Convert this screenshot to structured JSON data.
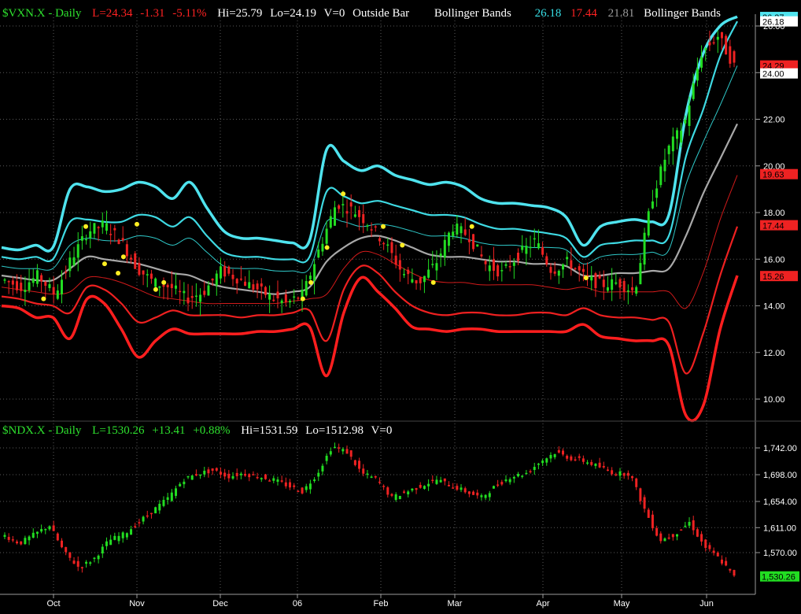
{
  "colors": {
    "background": "#000000",
    "grid": "#5a5a5a",
    "axis_line": "#9a9a9a",
    "axis_text": "#ffffff",
    "upper_thick": "#4fe3ee",
    "upper_mid": "#3ed9e2",
    "upper_thin": "#2fc9c9",
    "middle": "#a8a8a8",
    "lower_thin": "#d01a1a",
    "lower_mid": "#ee2020",
    "lower_thick": "#ff1e1e",
    "candle_up": "#22dd22",
    "candle_down": "#ee2222",
    "marker": "#ffee22",
    "header_green": "#2ee02e",
    "header_red": "#ff2222",
    "header_white": "#ffffff",
    "header_cyan": "#37dfe6",
    "header_gray": "#9a9a9a"
  },
  "top_header": {
    "symbol": "$VXN.X - Daily",
    "last": "L=24.34",
    "change": "-1.31",
    "pct": "-5.11%",
    "hi": "Hi=25.79",
    "lo": "Lo=24.19",
    "vol": "V=0",
    "pattern": "Outside Bar",
    "bb_label": "Bollinger Bands",
    "bb_upper": "26.18",
    "bb_lower": "17.44",
    "bb_mid": "21.81",
    "bb_label2": "Bollinger Bands"
  },
  "bottom_header": {
    "symbol": "$NDX.X - Daily",
    "last": "L=1530.26",
    "change": "+13.41",
    "pct": "+0.88%",
    "hi": "Hi=1531.59",
    "lo": "Lo=1512.98",
    "vol": "V=0"
  },
  "top_axis": {
    "ticks": [
      {
        "v": 26,
        "label": "26.00"
      },
      {
        "v": 24,
        "label": "24.00"
      },
      {
        "v": 22,
        "label": "22.00"
      },
      {
        "v": 20,
        "label": "20.00"
      },
      {
        "v": 18,
        "label": "18.00"
      },
      {
        "v": 16,
        "label": "16.00"
      },
      {
        "v": 14,
        "label": "14.00"
      },
      {
        "v": 12,
        "label": "12.00"
      },
      {
        "v": 10,
        "label": "10.00"
      }
    ],
    "badges": [
      {
        "v": 26.37,
        "label": "26.37",
        "bg": "#4fe3ee",
        "fg": "#000000"
      },
      {
        "v": 26.18,
        "label": "26.18",
        "bg": "#ffffff",
        "fg": "#000000"
      },
      {
        "v": 24.29,
        "label": "24.29",
        "bg": "#ee2222",
        "fg": "#000000"
      },
      {
        "v": 23.95,
        "label": "24.00",
        "bg": "#ffffff",
        "fg": "#000000"
      },
      {
        "v": 19.63,
        "label": "19.63",
        "bg": "#ee2222",
        "fg": "#000000"
      },
      {
        "v": 17.44,
        "label": "17.44",
        "bg": "#ee2222",
        "fg": "#000000"
      },
      {
        "v": 15.26,
        "label": "15.26",
        "bg": "#ee2222",
        "fg": "#000000"
      }
    ]
  },
  "bottom_axis": {
    "ticks": [
      {
        "v": 1742,
        "label": "1,742.00"
      },
      {
        "v": 1698,
        "label": "1,698.00"
      },
      {
        "v": 1654,
        "label": "1,654.00"
      },
      {
        "v": 1611,
        "label": "1,611.00"
      },
      {
        "v": 1570,
        "label": "1,570.00"
      }
    ],
    "badges": [
      {
        "v": 1530.26,
        "label": "1,530.26",
        "bg": "#22dd22",
        "fg": "#000000"
      }
    ]
  },
  "x_labels": [
    "Oct",
    "Nov",
    "Dec",
    "06",
    "Feb",
    "Mar",
    "Apr",
    "May",
    "Jun"
  ],
  "chart_data": [
    {
      "type": "candlestick",
      "title": "$VXN.X - Daily",
      "ylim": [
        9,
        27
      ],
      "grid": true,
      "months": [
        "Oct",
        "Nov",
        "Dec",
        "06",
        "Feb",
        "Mar",
        "Apr",
        "May",
        "Jun"
      ],
      "series": [
        {
          "name": "Upper Band (outer)",
          "values": [
            16.5,
            16.4,
            16.6,
            16.5,
            19.0,
            19.1,
            18.9,
            19.0,
            19.3,
            19.1,
            18.6,
            19.3,
            18.2,
            17.2,
            16.9,
            16.9,
            16.8,
            16.7,
            16.8,
            20.7,
            20.2,
            19.8,
            20.0,
            19.6,
            19.4,
            19.2,
            19.3,
            19.1,
            18.6,
            18.4,
            18.4,
            18.3,
            18.2,
            17.8,
            16.6,
            17.4,
            17.6,
            17.7,
            17.6,
            17.9,
            22.2,
            24.8,
            26.0,
            26.4
          ]
        },
        {
          "name": "Upper Band (mid)",
          "values": [
            16.1,
            16.0,
            16.1,
            16.0,
            17.6,
            17.7,
            17.6,
            17.6,
            17.9,
            17.8,
            17.4,
            17.8,
            17.0,
            16.3,
            16.1,
            16.1,
            16.0,
            16.0,
            16.1,
            18.9,
            18.7,
            18.4,
            18.5,
            18.3,
            18.1,
            17.9,
            17.9,
            17.8,
            17.5,
            17.3,
            17.3,
            17.2,
            17.1,
            16.9,
            16.1,
            16.6,
            16.7,
            16.8,
            16.8,
            17.0,
            20.4,
            22.4,
            24.7,
            26.2
          ]
        },
        {
          "name": "Upper Band (inner)",
          "values": [
            15.7,
            15.6,
            15.6,
            15.6,
            16.6,
            16.9,
            16.8,
            16.8,
            17.0,
            16.9,
            16.6,
            16.9,
            16.3,
            15.7,
            15.6,
            15.6,
            15.5,
            15.5,
            15.6,
            17.6,
            17.6,
            17.4,
            17.5,
            17.4,
            17.2,
            17.0,
            17.0,
            16.9,
            16.7,
            16.6,
            16.6,
            16.5,
            16.5,
            16.4,
            15.8,
            16.1,
            16.2,
            16.2,
            16.3,
            16.4,
            19.2,
            21.0,
            22.6,
            24.3
          ]
        },
        {
          "name": "Middle Band",
          "values": [
            15.3,
            15.2,
            15.1,
            15.1,
            15.6,
            16.1,
            16.0,
            15.9,
            15.8,
            15.6,
            15.4,
            15.3,
            15.0,
            14.8,
            14.7,
            14.6,
            14.5,
            14.6,
            14.8,
            15.9,
            16.5,
            16.9,
            17.0,
            16.8,
            16.5,
            16.2,
            16.1,
            16.1,
            16.0,
            15.9,
            15.9,
            15.8,
            15.8,
            15.7,
            15.3,
            15.3,
            15.4,
            15.4,
            15.5,
            15.6,
            17.0,
            18.8,
            20.3,
            21.8
          ]
        },
        {
          "name": "Lower Band (inner)",
          "values": [
            14.8,
            14.7,
            14.6,
            14.5,
            14.6,
            15.2,
            15.2,
            15.0,
            14.7,
            14.4,
            14.3,
            14.2,
            14.1,
            14.1,
            14.1,
            14.1,
            14.1,
            14.2,
            14.3,
            14.5,
            15.6,
            16.3,
            16.2,
            15.8,
            15.4,
            15.1,
            15.0,
            15.0,
            14.9,
            14.9,
            14.9,
            14.9,
            14.8,
            14.7,
            14.8,
            14.6,
            14.6,
            14.6,
            14.6,
            14.6,
            13.9,
            15.4,
            17.7,
            19.6
          ]
        },
        {
          "name": "Lower Band (mid)",
          "values": [
            14.4,
            14.3,
            14.1,
            14.0,
            13.7,
            14.8,
            14.7,
            14.1,
            13.3,
            13.5,
            13.8,
            13.6,
            13.6,
            13.6,
            13.5,
            13.6,
            13.6,
            13.7,
            13.8,
            12.5,
            14.7,
            15.7,
            15.4,
            14.6,
            14.0,
            13.7,
            13.6,
            13.7,
            13.7,
            13.6,
            13.6,
            13.7,
            13.7,
            13.6,
            13.9,
            13.6,
            13.5,
            13.5,
            13.4,
            13.3,
            11.1,
            12.8,
            15.3,
            17.4
          ]
        },
        {
          "name": "Lower Band (outer)",
          "values": [
            14.0,
            13.9,
            13.5,
            13.5,
            12.6,
            14.3,
            14.1,
            13.0,
            11.8,
            12.5,
            13.0,
            12.8,
            12.8,
            12.8,
            12.8,
            12.9,
            12.9,
            13.0,
            13.1,
            11.0,
            13.7,
            15.2,
            14.6,
            13.9,
            13.1,
            13.0,
            12.9,
            13.0,
            13.0,
            12.9,
            12.9,
            12.9,
            12.9,
            12.9,
            13.2,
            12.7,
            12.6,
            12.5,
            12.5,
            12.3,
            9.3,
            9.7,
            13.0,
            15.3
          ]
        }
      ],
      "candles": [
        15.1,
        14.8,
        15.3,
        14.5,
        16.0,
        17.2,
        17.5,
        16.8,
        15.6,
        15.0,
        14.8,
        14.3,
        14.6,
        15.5,
        15.2,
        14.8,
        14.4,
        14.1,
        14.5,
        16.5,
        18.4,
        18.1,
        17.5,
        16.6,
        15.4,
        15.0,
        15.8,
        17.4,
        17.0,
        15.8,
        15.4,
        16.2,
        16.8,
        15.5,
        15.9,
        15.2,
        14.9,
        15.0,
        14.6,
        18.5,
        20.7,
        21.8,
        24.8,
        25.6,
        24.3
      ],
      "markers": [
        {
          "date": "Sep-27",
          "y": 14.3
        },
        {
          "date": "Oct-12",
          "y": 17.4
        },
        {
          "date": "Oct-19",
          "y": 15.8
        },
        {
          "date": "Oct-24",
          "y": 15.4
        },
        {
          "date": "Oct-26",
          "y": 16.1
        },
        {
          "date": "Oct-31",
          "y": 17.5
        },
        {
          "date": "Nov-07",
          "y": 14.7
        },
        {
          "date": "Nov-10",
          "y": 15.0
        },
        {
          "date": "Jan-02",
          "y": 14.3
        },
        {
          "date": "Jan-05",
          "y": 15.0
        },
        {
          "date": "Jan-11",
          "y": 16.5
        },
        {
          "date": "Jan-17",
          "y": 18.8
        },
        {
          "date": "Feb-01",
          "y": 17.4
        },
        {
          "date": "Feb-09",
          "y": 16.6
        },
        {
          "date": "Feb-22",
          "y": 15.0
        },
        {
          "date": "Mar-06",
          "y": 17.4
        },
        {
          "date": "Apr-17",
          "y": 15.2
        }
      ]
    },
    {
      "type": "candlestick",
      "title": "$NDX.X - Daily",
      "ylim": [
        1522,
        1765
      ],
      "grid": true,
      "months": [
        "Oct",
        "Nov",
        "Dec",
        "06",
        "Feb",
        "Mar",
        "Apr",
        "May",
        "Jun"
      ],
      "candles": [
        1598,
        1585,
        1600,
        1615,
        1570,
        1545,
        1560,
        1590,
        1600,
        1620,
        1640,
        1660,
        1690,
        1700,
        1705,
        1695,
        1700,
        1695,
        1690,
        1680,
        1670,
        1700,
        1745,
        1735,
        1700,
        1690,
        1660,
        1670,
        1680,
        1690,
        1680,
        1670,
        1660,
        1680,
        1695,
        1700,
        1720,
        1735,
        1725,
        1720,
        1710,
        1700,
        1700,
        1640,
        1590,
        1600,
        1620,
        1580,
        1560,
        1530
      ]
    }
  ]
}
